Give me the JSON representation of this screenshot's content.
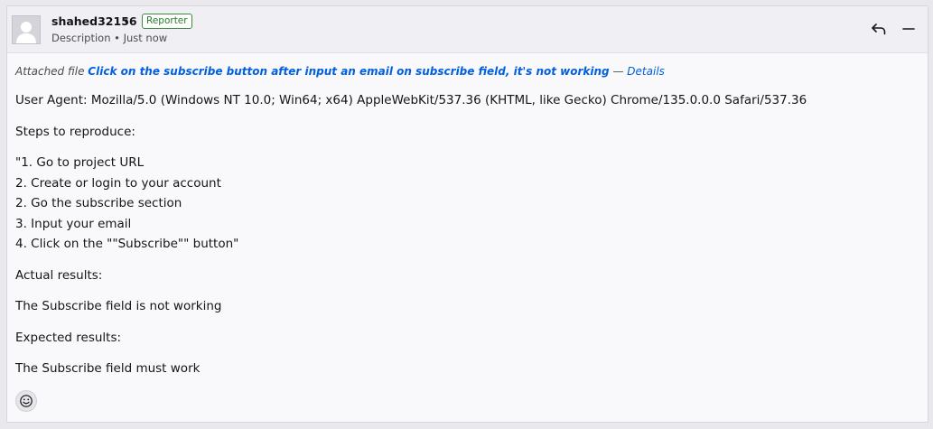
{
  "header": {
    "author": "shahed32156",
    "caret": "▾",
    "role": "Reporter",
    "meta": "Description • Just now"
  },
  "attachment": {
    "prefix": "Attached file",
    "link_text": "Click on the subscribe button after input an email on subscribe field, it's not working",
    "separator": "—",
    "details_text": "Details"
  },
  "body": {
    "user_agent": "User Agent: Mozilla/5.0 (Windows NT 10.0; Win64; x64) AppleWebKit/537.36 (KHTML, like Gecko) Chrome/135.0.0.0 Safari/537.36",
    "steps_heading": "Steps to reproduce:",
    "steps": [
      "\"1. Go to project URL",
      "2. Create or login to your account",
      "2. Go the subscribe section",
      "3. Input your email",
      "4. Click on the \"\"Subscribe\"\" button\""
    ],
    "actual_heading": "Actual results:",
    "actual_text": "The Subscribe field is not working",
    "expected_heading": "Expected results:",
    "expected_text": "The Subscribe field must work"
  },
  "icons": {
    "avatar": "default-user-avatar",
    "reply": "reply-icon",
    "collapse": "minus-icon",
    "emoji": "smiley-icon"
  }
}
